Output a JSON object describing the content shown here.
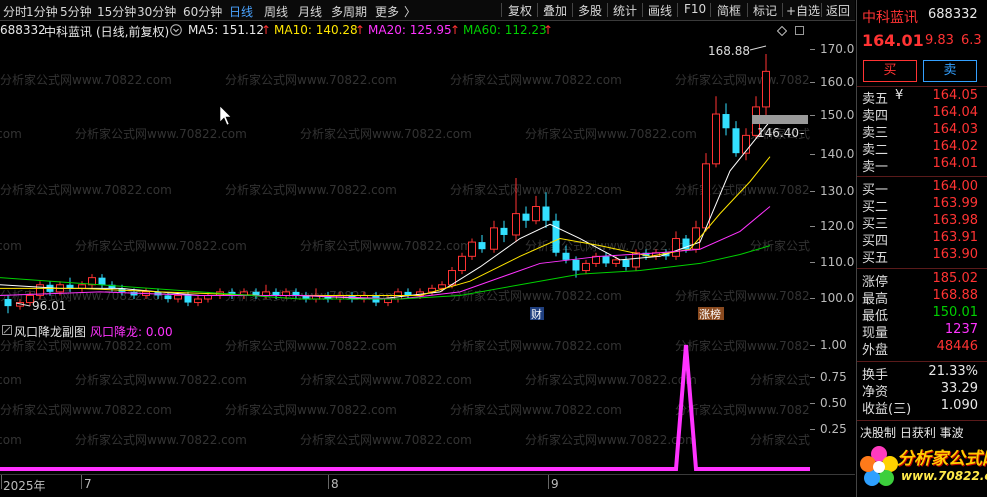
{
  "toolbar": {
    "tabs": [
      "分时",
      "1分钟",
      "5分钟",
      "15分钟",
      "30分钟",
      "60分钟",
      "日线",
      "周线",
      "月线",
      "多周期",
      "更多"
    ],
    "active_tab": "日线",
    "more_chevron": "〉",
    "buttons": [
      "复权",
      "叠加",
      "多股",
      "统计",
      "画线",
      "F10",
      "简框",
      "标记",
      "+自选",
      "返回"
    ]
  },
  "stock": {
    "code_trunc": "688332",
    "name": "中科蓝讯",
    "chart_mode": "(日线,前复权)",
    "dropdown_icon": "circle-chevron-down-icon",
    "ma5_label": "MA5: 151.12",
    "ma10_label": "MA10: 140.28",
    "ma20_label": "MA20: 125.95",
    "ma60_label": "MA60: 112.23",
    "up_arrow": "↑"
  },
  "colors": {
    "up": "#ff3333",
    "down": "#33e0ff",
    "ma5": "#ffffff",
    "ma10": "#ffe600",
    "ma20": "#ff33ff",
    "ma60": "#00d000",
    "indicator": "#ff33ff"
  },
  "main_chart": {
    "y_ticks": [
      "170.0",
      "160.0",
      "150.0",
      "140.0",
      "130.0",
      "120.0",
      "110.0",
      "100.0"
    ],
    "high_marker": "168.88",
    "low_marker": "96.01",
    "current_marker": "146.40",
    "current_marker_dash": "-",
    "badge_cai": "财",
    "badge_zhangbang": "涨榜",
    "watermark": "分析家公式网www.70822.com"
  },
  "sub_chart": {
    "title": "风口降龙副图",
    "indicator_label": "风口降龙: 0.00",
    "y_ticks": [
      "1.00",
      "0.75",
      "0.50",
      "0.25"
    ]
  },
  "x_axis": {
    "labels": [
      "2025年",
      "7",
      "8",
      "9"
    ]
  },
  "right_panel": {
    "name": "中科蓝讯",
    "code": "688332",
    "price": "164.01",
    "change": "9.83",
    "change_pct": "6.3",
    "buy_btn": "买",
    "sell_btn": "卖",
    "sell_orders": [
      {
        "label": "卖五",
        "extra": "¥",
        "price": "164.05"
      },
      {
        "label": "卖四",
        "extra": "",
        "price": "164.04"
      },
      {
        "label": "卖三",
        "extra": "",
        "price": "164.03"
      },
      {
        "label": "卖二",
        "extra": "",
        "price": "164.02"
      },
      {
        "label": "卖一",
        "extra": "",
        "price": "164.01"
      }
    ],
    "buy_orders": [
      {
        "label": "买一",
        "price": "164.00"
      },
      {
        "label": "买二",
        "price": "163.99"
      },
      {
        "label": "买三",
        "price": "163.98"
      },
      {
        "label": "买四",
        "price": "163.91"
      },
      {
        "label": "买五",
        "price": "163.90"
      }
    ],
    "stats1": [
      {
        "label": "涨停",
        "value": "185.02"
      },
      {
        "label": "最高",
        "value": "168.88"
      },
      {
        "label": "最低",
        "value": "150.01"
      },
      {
        "label": "现量",
        "value": "1237"
      },
      {
        "label": "外盘",
        "value": "48446"
      }
    ],
    "stats2": [
      {
        "label": "换手",
        "value": "21.33%"
      },
      {
        "label": "净资",
        "value": "33.29"
      },
      {
        "label": "收益(三)",
        "value": "1.090"
      }
    ],
    "footer_trunc": "决股制 日获利 事波",
    "logo_text": "分析家公式网",
    "logo_url": "www.70822.com"
  }
}
